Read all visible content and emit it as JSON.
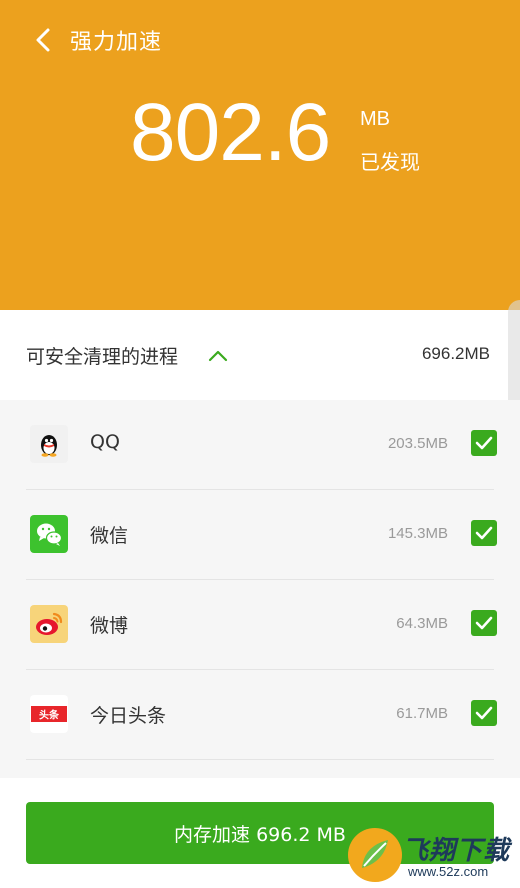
{
  "header": {
    "title": "强力加速",
    "back_icon": "chevron-left-icon",
    "found_amount": "802.6",
    "found_unit": "MB",
    "found_label": "已发现",
    "bg_color": "#eca11e"
  },
  "section": {
    "title": "可安全清理的进程",
    "toggle_icon": "chevron-up-icon",
    "total": "696.2MB"
  },
  "processes": [
    {
      "name": "QQ",
      "size": "203.5MB",
      "icon": "qq-icon",
      "checked": true
    },
    {
      "name": "微信",
      "size": "145.3MB",
      "icon": "wechat-icon",
      "checked": true
    },
    {
      "name": "微博",
      "size": "64.3MB",
      "icon": "weibo-icon",
      "checked": true
    },
    {
      "name": "今日头条",
      "size": "61.7MB",
      "icon": "toutiao-icon",
      "checked": true,
      "icon_text": "头条"
    }
  ],
  "action": {
    "label": "内存加速 696.2 MB",
    "color": "#3aaa1e"
  },
  "watermark": {
    "text": "飞翔下载",
    "url": "www.52z.com"
  }
}
